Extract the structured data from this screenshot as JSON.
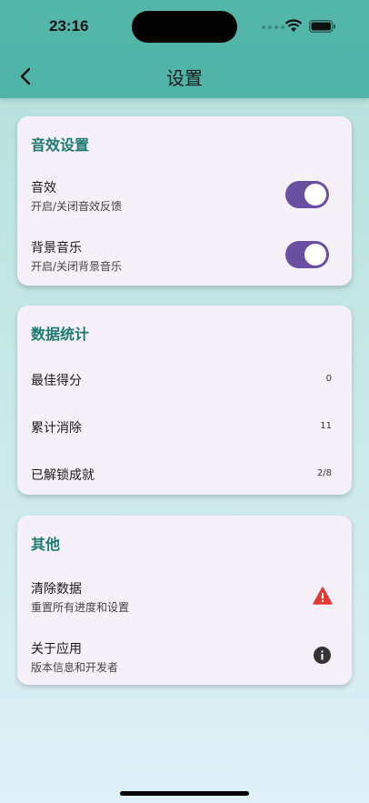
{
  "status": {
    "time": "23:16"
  },
  "header": {
    "title": "设置"
  },
  "sound_card": {
    "title": "音效设置",
    "items": [
      {
        "title": "音效",
        "subtitle": "开启/关闭音效反馈",
        "enabled": true
      },
      {
        "title": "背景音乐",
        "subtitle": "开启/关闭背景音乐",
        "enabled": true
      }
    ]
  },
  "stats_card": {
    "title": "数据统计",
    "items": [
      {
        "label": "最佳得分",
        "value": "0"
      },
      {
        "label": "累计消除",
        "value": "11"
      },
      {
        "label": "已解锁成就",
        "value": "2/8"
      }
    ]
  },
  "other_card": {
    "title": "其他",
    "items": [
      {
        "title": "清除数据",
        "subtitle": "重置所有进度和设置",
        "icon": "warning-icon"
      },
      {
        "title": "关于应用",
        "subtitle": "版本信息和开发者",
        "icon": "info-icon"
      }
    ]
  },
  "colors": {
    "accent": "#1c7a70",
    "toggle_on": "#6a4fa3",
    "warning": "#e53935",
    "header": "#52b6a8"
  }
}
